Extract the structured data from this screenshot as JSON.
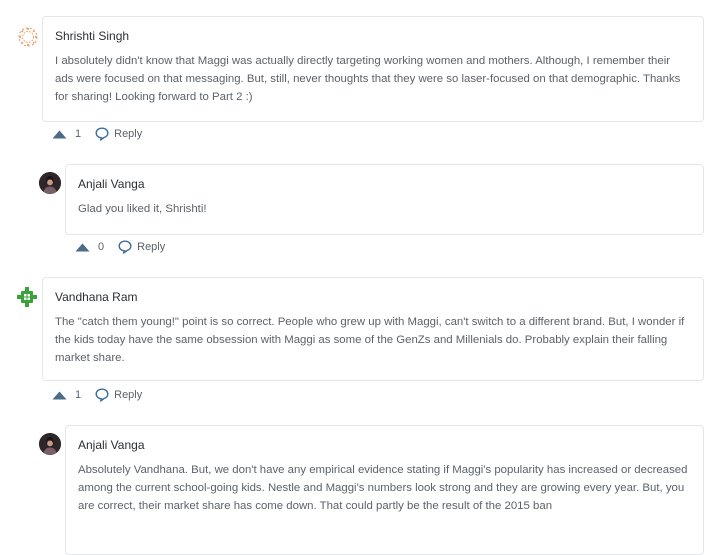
{
  "comments": [
    {
      "author": "Shrishti Singh",
      "avatar_icon": "mandala-avatar-icon",
      "text": "I absolutely didn't know that Maggi was actually directly targeting working women and mothers. Although, I remember their ads were focused on that messaging. But, still, never thoughts that they were so laser-focused on that demographic. Thanks for sharing! Looking forward to Part 2 :)",
      "upvotes": "1",
      "reply_label": "Reply"
    },
    {
      "author": "Anjali Vanga",
      "avatar_icon": "profile-photo-avatar",
      "text": "Glad you liked it, Shrishti!",
      "upvotes": "0",
      "reply_label": "Reply"
    },
    {
      "author": "Vandhana Ram",
      "avatar_icon": "green-pattern-avatar-icon",
      "text": "The \"catch them young!\" point is so correct. People who grew up with Maggi, can't switch to a different brand. But, I wonder if the kids today have the same obsession with Maggi as some of the GenZs and Millenials do. Probably explain their falling market share.",
      "upvotes": "1",
      "reply_label": "Reply"
    },
    {
      "author": "Anjali Vanga",
      "avatar_icon": "profile-photo-avatar",
      "text": "Absolutely Vandhana. But, we don't have any empirical evidence stating if Maggi's popularity has increased or decreased among the current school-going kids. Nestle and Maggi's numbers look strong and they are growing every year. But, you are correct, their market share has come down. That could partly be the result of the 2015 ban"
    }
  ],
  "colors": {
    "border": "#e4e6ea",
    "upvote_icon": "#4d6a86",
    "reply_icon": "#3b6d9a",
    "mandala": "#e9a97a",
    "green_avatar": "#3aa23a"
  }
}
